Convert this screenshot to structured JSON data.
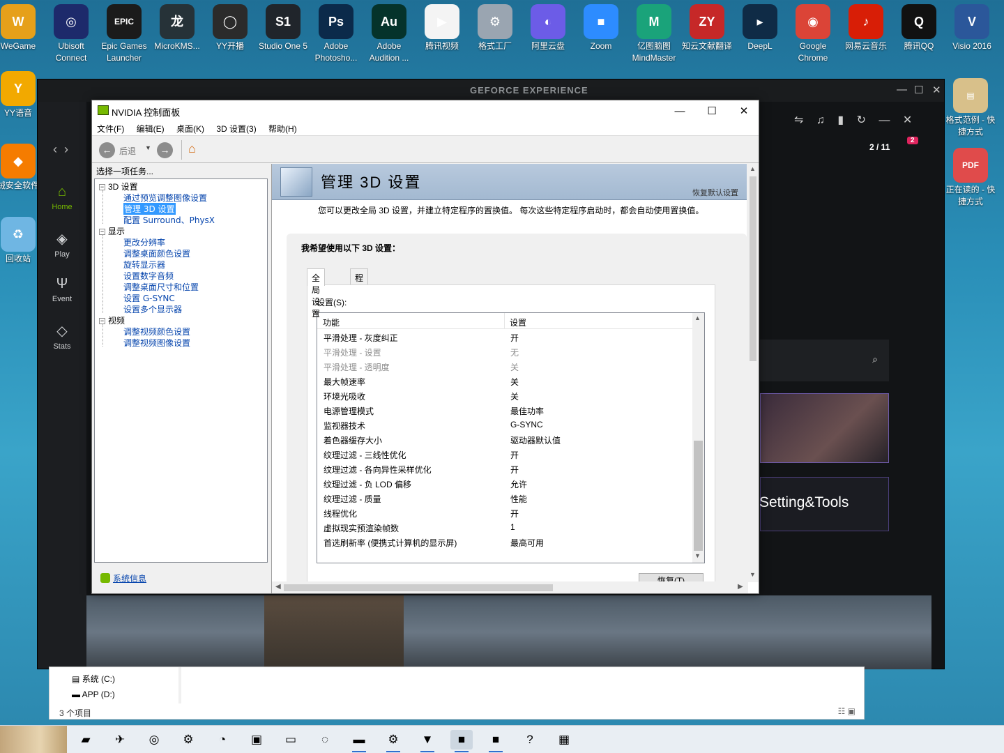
{
  "desktop": {
    "top_icons": [
      {
        "label": "WeGame",
        "glyph": "W",
        "color": "#e6a01a"
      },
      {
        "label": "Ubisoft Connect",
        "glyph": "◎",
        "color": "#1d2a6b"
      },
      {
        "label": "Epic Games Launcher",
        "glyph": "EPIC",
        "color": "#1b1b1b"
      },
      {
        "label": "MicroKMS...",
        "glyph": "龙",
        "color": "#263238"
      },
      {
        "label": "YY开播",
        "glyph": "◯",
        "color": "#2b2b2b"
      },
      {
        "label": "Studio One 5",
        "glyph": "S1",
        "color": "#20252b"
      },
      {
        "label": "Adobe Photosho...",
        "glyph": "Ps",
        "color": "#0b2a4a"
      },
      {
        "label": "Adobe Audition ...",
        "glyph": "Au",
        "color": "#05332b"
      },
      {
        "label": "腾讯视频",
        "glyph": "▶",
        "color": "#f4f4f4"
      },
      {
        "label": "格式工厂",
        "glyph": "⚙",
        "color": "#9aa5b1"
      },
      {
        "label": "阿里云盘",
        "glyph": "◐",
        "color": "#6c5ce7"
      },
      {
        "label": "Zoom",
        "glyph": "■",
        "color": "#2d8cff"
      },
      {
        "label": "亿图脑图 MindMaster",
        "glyph": "M",
        "color": "#1aa37a"
      },
      {
        "label": "知云文献翻译",
        "glyph": "ZY",
        "color": "#c62828"
      },
      {
        "label": "DeepL",
        "glyph": "▸",
        "color": "#0f2b46"
      },
      {
        "label": "Google Chrome",
        "glyph": "◉",
        "color": "#db4437"
      },
      {
        "label": "网易云音乐",
        "glyph": "♪",
        "color": "#d81e06"
      },
      {
        "label": "腾讯QQ",
        "glyph": "Q",
        "color": "#111111"
      },
      {
        "label": "Visio 2016",
        "glyph": "V",
        "color": "#2b579a"
      }
    ],
    "left_icons": [
      {
        "label": "YY语音",
        "glyph": "Y",
        "color": "#f2a900"
      },
      {
        "label": "绒安全软件",
        "glyph": "◆",
        "color": "#f57c00"
      },
      {
        "label": "回收站",
        "glyph": "♻",
        "color": "#6fb6e3"
      }
    ],
    "right_icons": [
      {
        "label": "格式范例 - 快捷方式",
        "glyph": "▤",
        "color": "#d8c08a"
      },
      {
        "label": "正在读的 - 快捷方式",
        "glyph": "PDF",
        "color": "#e04b4b"
      }
    ]
  },
  "gfe": {
    "title": "GEFORCE EXPERIENCE",
    "nav": [
      {
        "label": "Home",
        "icon": "⌂",
        "active": true
      },
      {
        "label": "Play",
        "icon": "◈",
        "active": false
      },
      {
        "label": "Event",
        "icon": "Ψ",
        "active": false
      },
      {
        "label": "Stats",
        "icon": "◇",
        "active": false
      }
    ],
    "badge": "2 / 11",
    "badge_count": "2",
    "card_text": "Setting&Tools"
  },
  "explorer": {
    "drives": [
      "系统 (C:)",
      "APP (D:)"
    ],
    "status": "3 个项目"
  },
  "ncp": {
    "title": "NVIDIA 控制面板",
    "menu": [
      "文件(F)",
      "编辑(E)",
      "桌面(K)",
      "3D 设置(3)",
      "帮助(H)"
    ],
    "back_label": "后退",
    "task_header": "选择一项任务...",
    "tree": {
      "groups": [
        {
          "label": "3D 设置",
          "items": [
            "通过预览调整图像设置",
            "管理 3D 设置",
            "配置 Surround、PhysX"
          ]
        },
        {
          "label": "显示",
          "items": [
            "更改分辨率",
            "调整桌面颜色设置",
            "旋转显示器",
            "设置数字音频",
            "调整桌面尺寸和位置",
            "设置 G-SYNC",
            "设置多个显示器"
          ]
        },
        {
          "label": "视频",
          "items": [
            "调整视频颜色设置",
            "调整视频图像设置"
          ]
        }
      ],
      "selected": "管理 3D 设置"
    },
    "sysinfo": "系统信息",
    "page_title": "管理 3D 设置",
    "restore_defaults": "恢复默认设置",
    "description": "您可以更改全局 3D 设置，并建立特定程序的置换值。 每次这些特定程序启动时，都会自动使用置换值。",
    "section_heading": "我希望使用以下 3D 设置：",
    "tabs": [
      "全局设置",
      "程序设置"
    ],
    "settings_label": "设置(S):",
    "columns": [
      "功能",
      "设置"
    ],
    "rows": [
      {
        "feature": "平滑处理 - 灰度纠正",
        "value": "开",
        "disabled": false
      },
      {
        "feature": "平滑处理 - 设置",
        "value": "无",
        "disabled": true
      },
      {
        "feature": "平滑处理 - 透明度",
        "value": "关",
        "disabled": true
      },
      {
        "feature": "最大帧速率",
        "value": "关",
        "disabled": false
      },
      {
        "feature": "环境光吸收",
        "value": "关",
        "disabled": false
      },
      {
        "feature": "电源管理模式",
        "value": "最佳功率",
        "disabled": false
      },
      {
        "feature": "监视器技术",
        "value": "G-SYNC",
        "disabled": false
      },
      {
        "feature": "着色器缓存大小",
        "value": "驱动器默认值",
        "disabled": false
      },
      {
        "feature": "纹理过滤 - 三线性优化",
        "value": "开",
        "disabled": false
      },
      {
        "feature": "纹理过滤 - 各向异性采样优化",
        "value": "开",
        "disabled": false
      },
      {
        "feature": "纹理过滤 - 负 LOD 偏移",
        "value": "允许",
        "disabled": false
      },
      {
        "feature": "纹理过滤 - 质量",
        "value": "性能",
        "disabled": false
      },
      {
        "feature": "线程优化",
        "value": "开",
        "disabled": false
      },
      {
        "feature": "虚拟现实预渲染帧数",
        "value": "1",
        "disabled": false
      },
      {
        "feature": "首选刷新率 (便携式计算机的显示屏)",
        "value": "最高可用",
        "disabled": false
      }
    ],
    "restore_button": "恢复(T)"
  },
  "taskbar": {
    "items": [
      {
        "name": "sticky-notes-icon",
        "glyph": "▰"
      },
      {
        "name": "feishu-icon",
        "glyph": "✈"
      },
      {
        "name": "disc-icon",
        "glyph": "◎"
      },
      {
        "name": "settings-icon",
        "glyph": "⚙"
      },
      {
        "name": "search-icon",
        "glyph": "◔"
      },
      {
        "name": "control-panel-icon",
        "glyph": "▣"
      },
      {
        "name": "computer-icon",
        "glyph": "▭"
      },
      {
        "name": "edge-icon",
        "glyph": "◌"
      },
      {
        "name": "file-explorer-icon",
        "glyph": "▬"
      },
      {
        "name": "steam-icon",
        "glyph": "⚙"
      },
      {
        "name": "geforce-icon",
        "glyph": "▼"
      },
      {
        "name": "nvidia-panel-icon",
        "glyph": "■"
      },
      {
        "name": "nvidia-panel-2-icon",
        "glyph": "■"
      },
      {
        "name": "help-icon",
        "glyph": "?"
      },
      {
        "name": "photos-icon",
        "glyph": "▦"
      }
    ]
  }
}
